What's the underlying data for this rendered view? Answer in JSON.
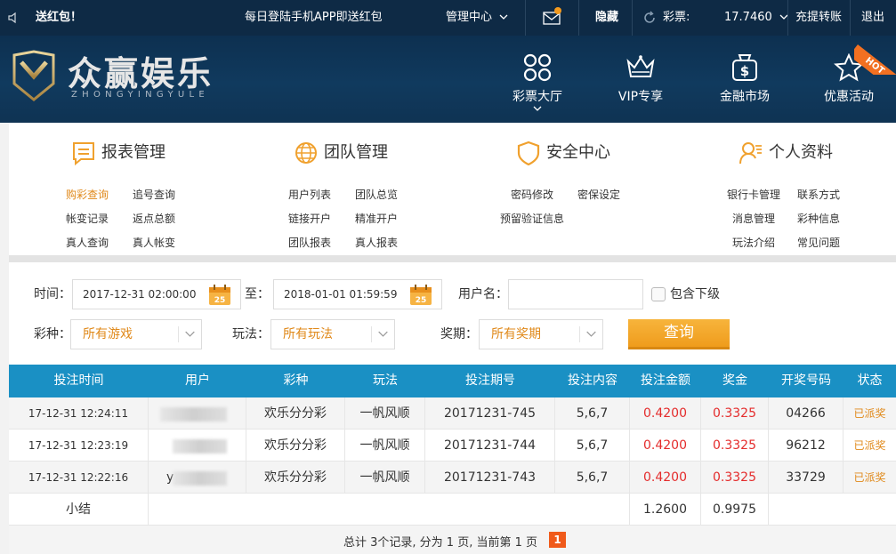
{
  "topbar": {
    "marquee": "送红包！",
    "promo": "每日登陆手机APP即送红包",
    "management": "管理中心",
    "hide": "隐藏",
    "lottery_label": "彩票:",
    "balance": "17.7460",
    "deposit": "充提转账",
    "logout": "退出"
  },
  "header": {
    "logo_cn": "众赢娱乐",
    "logo_en": "ZHONGYINGYULE",
    "nav": [
      {
        "label": "彩票大厅",
        "icon": "grid-icon"
      },
      {
        "label": "VIP专享",
        "icon": "crown-icon"
      },
      {
        "label": "金融市场",
        "icon": "money-bag-icon"
      },
      {
        "label": "优惠活动",
        "icon": "star-icon"
      }
    ],
    "hot": "HOT"
  },
  "menu": {
    "groups": [
      {
        "title": "报表管理",
        "icon": "report-icon",
        "links": [
          "购彩查询",
          "追号查询",
          "帐变记录",
          "返点总额",
          "真人查询",
          "真人帐变"
        ]
      },
      {
        "title": "团队管理",
        "icon": "globe-icon",
        "links": [
          "用户列表",
          "团队总览",
          "链接开户",
          "精准开户",
          "团队报表",
          "真人报表"
        ]
      },
      {
        "title": "安全中心",
        "icon": "shield-icon",
        "links": [
          "密码修改",
          "密保设定",
          "预留验证信息"
        ]
      },
      {
        "title": "个人资料",
        "icon": "user-icon",
        "links": [
          "银行卡管理",
          "联系方式",
          "消息管理",
          "彩种信息",
          "玩法介绍",
          "常见问题"
        ]
      }
    ]
  },
  "filters": {
    "time_label": "时间：",
    "start_time": "2017-12-31 02:00:00",
    "to_label": "至：",
    "end_time": "2018-01-01 01:59:59",
    "calendar_day": "25",
    "username_label": "用户名：",
    "username_value": "",
    "include_sub": "包含下级",
    "game_label": "彩种：",
    "game_value": "所有游戏",
    "play_label": "玩法：",
    "play_value": "所有玩法",
    "period_label": "奖期：",
    "period_value": "所有奖期",
    "query": "查询"
  },
  "table": {
    "headers": [
      "投注时间",
      "用户",
      "彩种",
      "玩法",
      "投注期号",
      "投注内容",
      "投注金额",
      "奖金",
      "开奖号码",
      "状态"
    ],
    "rows": [
      {
        "time": "17-12-31 12:24:11",
        "user": "",
        "game": "欢乐分分彩",
        "play": "一帆风顺",
        "issue": "20171231-745",
        "content": "5,6,7",
        "amount": "0.4200",
        "prize": "0.3325",
        "numbers": "04266",
        "status": "已派奖"
      },
      {
        "time": "17-12-31 12:23:19",
        "user": "",
        "game": "欢乐分分彩",
        "play": "一帆风顺",
        "issue": "20171231-744",
        "content": "5,6,7",
        "amount": "0.4200",
        "prize": "0.3325",
        "numbers": "96212",
        "status": "已派奖"
      },
      {
        "time": "17-12-31 12:22:16",
        "user": "y",
        "game": "欢乐分分彩",
        "play": "一帆风顺",
        "issue": "20171231-743",
        "content": "5,6,7",
        "amount": "0.4200",
        "prize": "0.3325",
        "numbers": "33729",
        "status": "已派奖"
      }
    ],
    "subtotal_label": "小结",
    "subtotal_amount": "1.2600",
    "subtotal_prize": "0.9975"
  },
  "pager": {
    "text": "总计 3个记录, 分为 1 页, 当前第 1 页",
    "current": "1"
  },
  "colors": {
    "header_bg": "#0e2a45",
    "table_header": "#1a90c4",
    "accent_orange": "#e0891a",
    "amount_red": "#e42c2c",
    "button_orange": "#f4a82c"
  }
}
